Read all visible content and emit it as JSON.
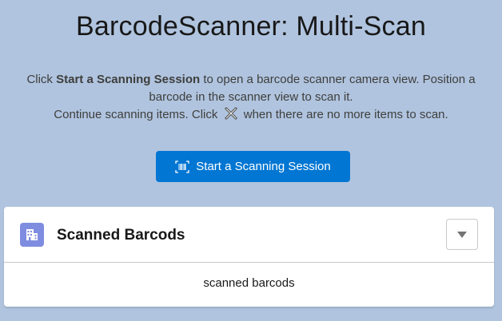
{
  "page": {
    "title": "BarcodeScanner: Multi-Scan"
  },
  "instructions": {
    "line1_prefix": "Click ",
    "line1_bold": "Start a Scanning Session",
    "line1_suffix": " to open a barcode scanner camera view. Position a barcode in the scanner view to scan it.",
    "line2_prefix": "Continue scanning items. Click ",
    "line2_icon": "close-x-icon",
    "line2_suffix": " when there are no more items to scan."
  },
  "start_button": {
    "label": "Start a Scanning Session",
    "icon": "barcode-icon"
  },
  "card": {
    "title": "Scanned Barcods",
    "icon": "building-icon",
    "menu_icon": "chevron-down-icon",
    "body_text": "scanned barcods"
  },
  "colors": {
    "background": "#b0c4df",
    "brand": "#0176d3",
    "card_icon": "#7f8de1"
  }
}
